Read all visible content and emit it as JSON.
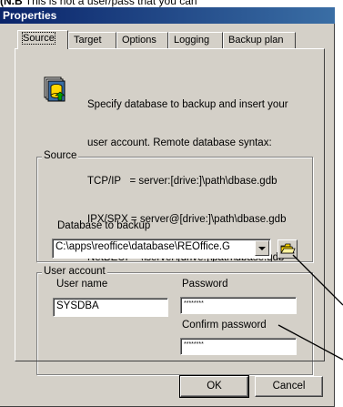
{
  "top_caption": {
    "prefix": "(N.B",
    "text": " This is not a user/pass that you can"
  },
  "window": {
    "title": "Properties"
  },
  "tabs": [
    {
      "label": "Source",
      "active": true
    },
    {
      "label": "Target",
      "active": false
    },
    {
      "label": "Options",
      "active": false
    },
    {
      "label": "Logging",
      "active": false
    },
    {
      "label": "Backup plan",
      "active": false
    }
  ],
  "intro": {
    "icon": "database-icon",
    "lines": [
      "Specify database to backup and insert your",
      "user account. Remote database syntax:",
      "TCP/IP   = server:[drive:]\\path\\dbase.gdb",
      "IPX/SPX = server@[drive:]\\path\\dbase.gdb",
      "NetBEUI = \\\\server\\[drive:]\\path\\dbase.gdb"
    ]
  },
  "source": {
    "group_label": "Source",
    "database_label": "Database to backup",
    "database_value": "C:\\apps\\reoffice\\database\\REOffice.G",
    "browse_icon": "folder-open-icon"
  },
  "account": {
    "group_label": "User account",
    "username_label": "User name",
    "username_value": "SYSDBA",
    "password_label": "Password",
    "password_value": "********",
    "confirm_label": "Confirm password",
    "confirm_value": "********"
  },
  "buttons": {
    "ok": "OK",
    "cancel": "Cancel"
  }
}
